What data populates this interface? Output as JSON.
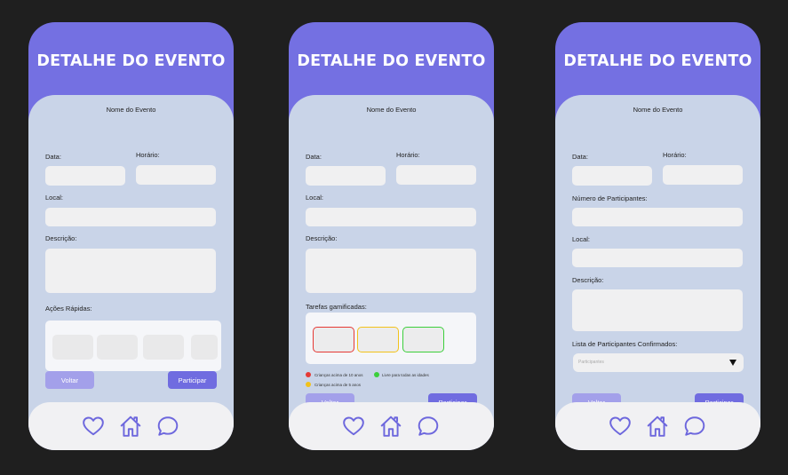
{
  "colors": {
    "accent": "#7470e2",
    "content_bg": "#c9d4e8",
    "field_bg": "#f0f0f1",
    "nav_bg": "#f1f1f3",
    "button_primary": "#706ce0",
    "button_secondary": "#a3a0ea",
    "legend_red": "#e53935",
    "legend_yellow": "#f2c21b",
    "legend_green": "#3ccf3c"
  },
  "screen1": {
    "title": "DETALHE DO EVENTO",
    "event_name": "Nome do Evento",
    "date_label": "Data:",
    "time_label": "Horário:",
    "location_label": "Local:",
    "description_label": "Descrição:",
    "quick_actions_label": "Ações Rápidas:",
    "back_button": "Voltar",
    "join_button": "Participar"
  },
  "screen2": {
    "title": "DETALHE DO EVENTO",
    "event_name": "Nome do Evento",
    "date_label": "Data:",
    "time_label": "Horário:",
    "location_label": "Local:",
    "description_label": "Descrição:",
    "tasks_label": "Tarefas gamificadas:",
    "legend": [
      {
        "label": "Crianças acima de 10 anos",
        "color": "#e53935"
      },
      {
        "label": "Livre para todas as idades",
        "color": "#3ccf3c"
      },
      {
        "label": "Crianças acima de 5 anos",
        "color": "#f2c21b"
      }
    ],
    "back_button": "Voltar",
    "join_button": "Participar"
  },
  "screen3": {
    "title": "DETALHE DO EVENTO",
    "event_name": "Nome do Evento",
    "date_label": "Data:",
    "time_label": "Horário:",
    "participants_count_label": "Número de Participantes:",
    "location_label": "Local:",
    "description_label": "Descrição:",
    "confirmed_list_label": "Lista de Participantes Confirmados:",
    "select_placeholder": "Participantes",
    "back_button": "Voltar",
    "join_button": "Participar"
  },
  "nav_icons": [
    "heart-icon",
    "home-icon",
    "chat-bubble-icon"
  ]
}
